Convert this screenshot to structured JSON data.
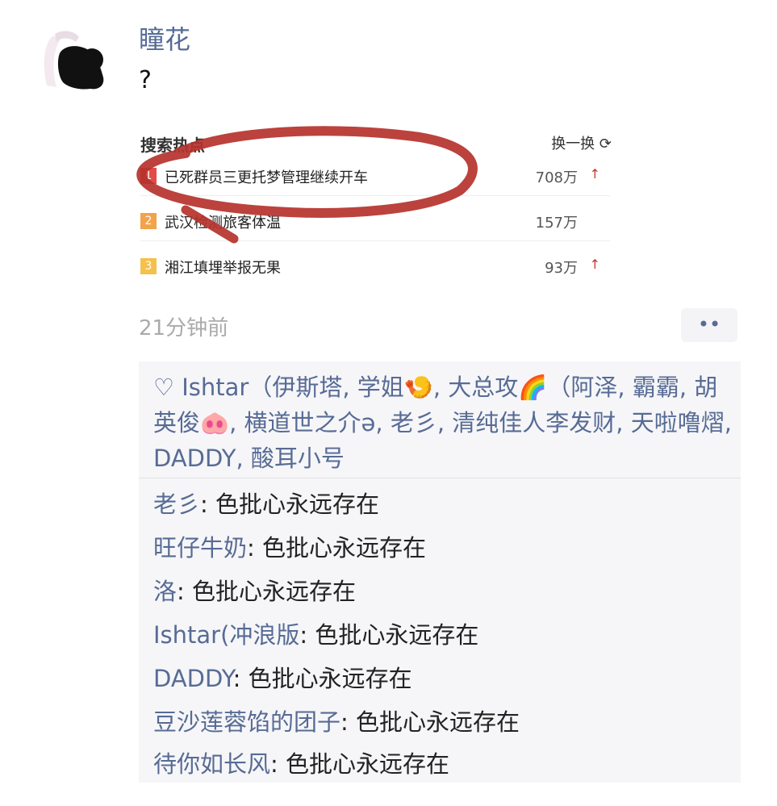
{
  "post": {
    "author": "瞳花",
    "text": "?",
    "time": "21分钟前",
    "more_label": "••"
  },
  "shared_card": {
    "header": "搜索热点",
    "refresh": "换一换 ⟳",
    "items": [
      {
        "rank": "1",
        "title": "已死群员三更托梦管理继续开车",
        "count": "708万",
        "trend": "↑"
      },
      {
        "rank": "2",
        "title": "武汉检测旅客体温",
        "count": "157万",
        "trend": ""
      },
      {
        "rank": "3",
        "title": "湘江填埋举报无果",
        "count": "93万",
        "trend": "↑"
      }
    ],
    "colors": {
      "rank1": "#e14c47",
      "rank2": "#f2a34b",
      "rank3": "#f5c04b",
      "annotation": "#b5322c"
    }
  },
  "likes": {
    "icon": "heart-outline-icon",
    "text": "Ishtar（伊斯塔, 学姐🍤, 大总攻🌈（阿泽, 霸霸, 胡英俊🐽, 横道世之介ə, 老彡, 清纯佳人李发财, 天啦噜熠, DADDY, 酸耳小号"
  },
  "comments": [
    {
      "author": "老彡",
      "text": "色批心永远存在"
    },
    {
      "author": "旺仔牛奶",
      "text": "色批心永远存在"
    },
    {
      "author": "洛",
      "text": "色批心永远存在"
    },
    {
      "author": "Ishtar(冲浪版",
      "text": "色批心永远存在"
    },
    {
      "author": "DADDY",
      "text": "色批心永远存在"
    },
    {
      "author": "豆沙莲蓉馅的团子",
      "text": "色批心永远存在"
    },
    {
      "author": "待你如长风",
      "text": "色批心永远存在"
    }
  ]
}
